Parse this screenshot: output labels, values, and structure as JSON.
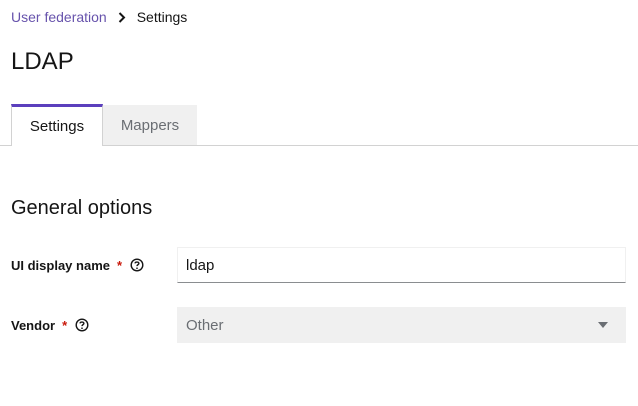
{
  "breadcrumb": {
    "parent_label": "User federation",
    "separator_icon": "chevron-right-icon",
    "current_label": "Settings"
  },
  "page": {
    "title": "LDAP"
  },
  "tabs": [
    {
      "label": "Settings",
      "active": true
    },
    {
      "label": "Mappers",
      "active": false
    }
  ],
  "general_options": {
    "title": "General options",
    "display_name": {
      "label": "UI display name",
      "required_mark": "*",
      "help_icon": "help-circle-icon",
      "value": "ldap"
    },
    "vendor": {
      "label": "Vendor",
      "required_mark": "*",
      "help_icon": "help-circle-icon",
      "selected": "Other",
      "dropdown_icon": "caret-down-icon"
    }
  },
  "colors": {
    "link": "#6753ac",
    "active_tab_accent": "#5b3fbd",
    "required": "#c9190b",
    "disabled_bg": "#f0f0f0"
  }
}
